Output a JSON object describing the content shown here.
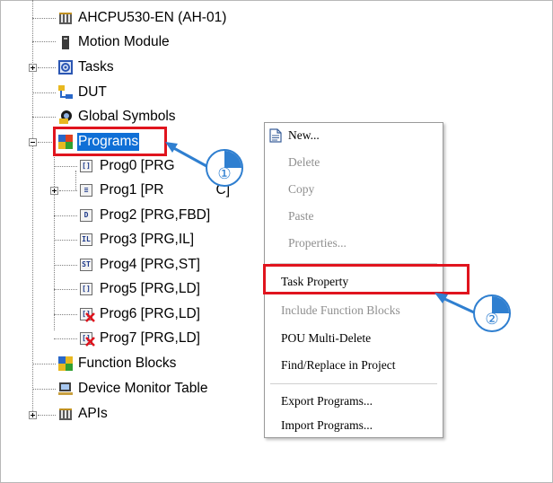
{
  "tree": {
    "items": [
      {
        "label": "AHCPU530-EN  (AH-01)",
        "icon": "plc-cpu-icon"
      },
      {
        "label": "Motion Module",
        "icon": "module-icon"
      },
      {
        "label": "Tasks",
        "icon": "tasks-icon"
      },
      {
        "label": "DUT",
        "icon": "dut-icon"
      },
      {
        "label": "Global Symbols",
        "icon": "global-symbols-icon"
      },
      {
        "label": "Programs",
        "icon": "programs-icon",
        "selected": true
      },
      {
        "label": "Prog0 [PRG",
        "icon": "ld-program-icon",
        "badge": "LD"
      },
      {
        "label": "Prog1 [PR",
        "label_tail": "C]",
        "icon": "sfc-program-icon",
        "badge": "SFC"
      },
      {
        "label": "Prog2 [PRG,FBD]",
        "icon": "fbd-program-icon",
        "badge": "FBD"
      },
      {
        "label": "Prog3 [PRG,IL]",
        "icon": "il-program-icon",
        "badge": "IL"
      },
      {
        "label": "Prog4 [PRG,ST]",
        "icon": "st-program-icon",
        "badge": "ST"
      },
      {
        "label": "Prog5 [PRG,LD]",
        "icon": "ld-program-icon",
        "badge": "LD"
      },
      {
        "label": "Prog6 [PRG,LD]",
        "icon": "ld-program-disabled-icon",
        "badge": "LD"
      },
      {
        "label": "Prog7 [PRG,LD]",
        "icon": "ld-program-disabled-icon",
        "badge": "LD"
      },
      {
        "label": "Function Blocks",
        "icon": "function-blocks-icon"
      },
      {
        "label": "Device Monitor Table",
        "icon": "device-monitor-icon"
      },
      {
        "label": "APIs",
        "icon": "apis-icon"
      }
    ]
  },
  "context_menu": {
    "items": [
      {
        "label": "New...",
        "enabled": true
      },
      {
        "label": "Delete",
        "enabled": false
      },
      {
        "label": "Copy",
        "enabled": false
      },
      {
        "label": "Paste",
        "enabled": false
      },
      {
        "label": "Properties...",
        "enabled": false
      },
      {
        "label": "Task Property",
        "enabled": true
      },
      {
        "label": "Include Function Blocks",
        "enabled": false
      },
      {
        "label": "POU Multi-Delete",
        "enabled": true
      },
      {
        "label": "Find/Replace in Project",
        "enabled": true
      },
      {
        "label": "Export Programs...",
        "enabled": true
      },
      {
        "label": "Import Programs...",
        "enabled": true
      }
    ]
  },
  "callouts": [
    {
      "number": "①"
    },
    {
      "number": "②"
    }
  ],
  "colors": {
    "highlight_red": "#e0141e",
    "callout_blue": "#2f7fd0",
    "selection_blue": "#0f6fd6"
  }
}
